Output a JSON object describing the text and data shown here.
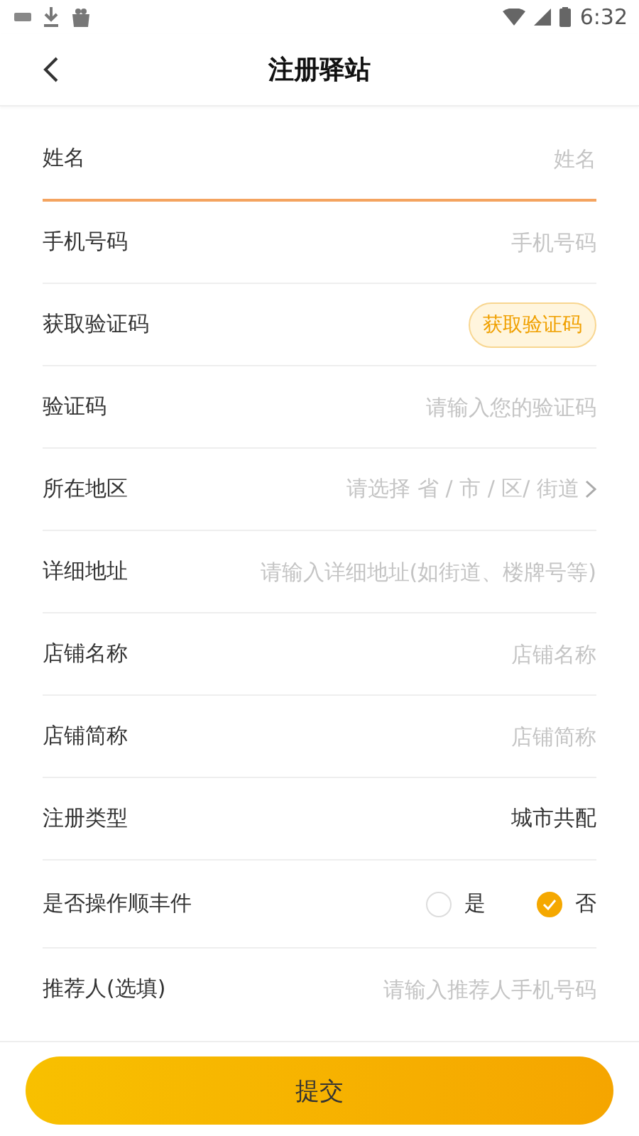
{
  "status_bar": {
    "time": "6:32"
  },
  "header": {
    "title": "注册驿站"
  },
  "fields": [
    {
      "kind": "input",
      "label": "姓名",
      "placeholder": "姓名",
      "focused": true
    },
    {
      "kind": "input",
      "label": "手机号码",
      "placeholder": "手机号码",
      "focused": false
    },
    {
      "kind": "button",
      "label": "获取验证码",
      "button": "获取验证码"
    },
    {
      "kind": "input",
      "label": "验证码",
      "placeholder": "请输入您的验证码",
      "focused": false
    },
    {
      "kind": "select",
      "label": "所在地区",
      "placeholder": "请选择 省 / 市 / 区/ 街道"
    },
    {
      "kind": "input",
      "label": "详细地址",
      "placeholder": "请输入详细地址(如街道、楼牌号等)",
      "focused": false
    },
    {
      "kind": "input",
      "label": "店铺名称",
      "placeholder": "店铺名称",
      "focused": false
    },
    {
      "kind": "input",
      "label": "店铺简称",
      "placeholder": "店铺简称",
      "focused": false
    },
    {
      "kind": "value",
      "label": "注册类型",
      "value": "城市共配"
    },
    {
      "kind": "radio",
      "label": "是否操作顺丰件",
      "options": [
        {
          "label": "是",
          "selected": false
        },
        {
          "label": "否",
          "selected": true
        }
      ]
    },
    {
      "kind": "input",
      "label": "推荐人(选填)",
      "placeholder": "请输入推荐人手机号码",
      "focused": false
    }
  ],
  "submit": {
    "label": "提交"
  }
}
